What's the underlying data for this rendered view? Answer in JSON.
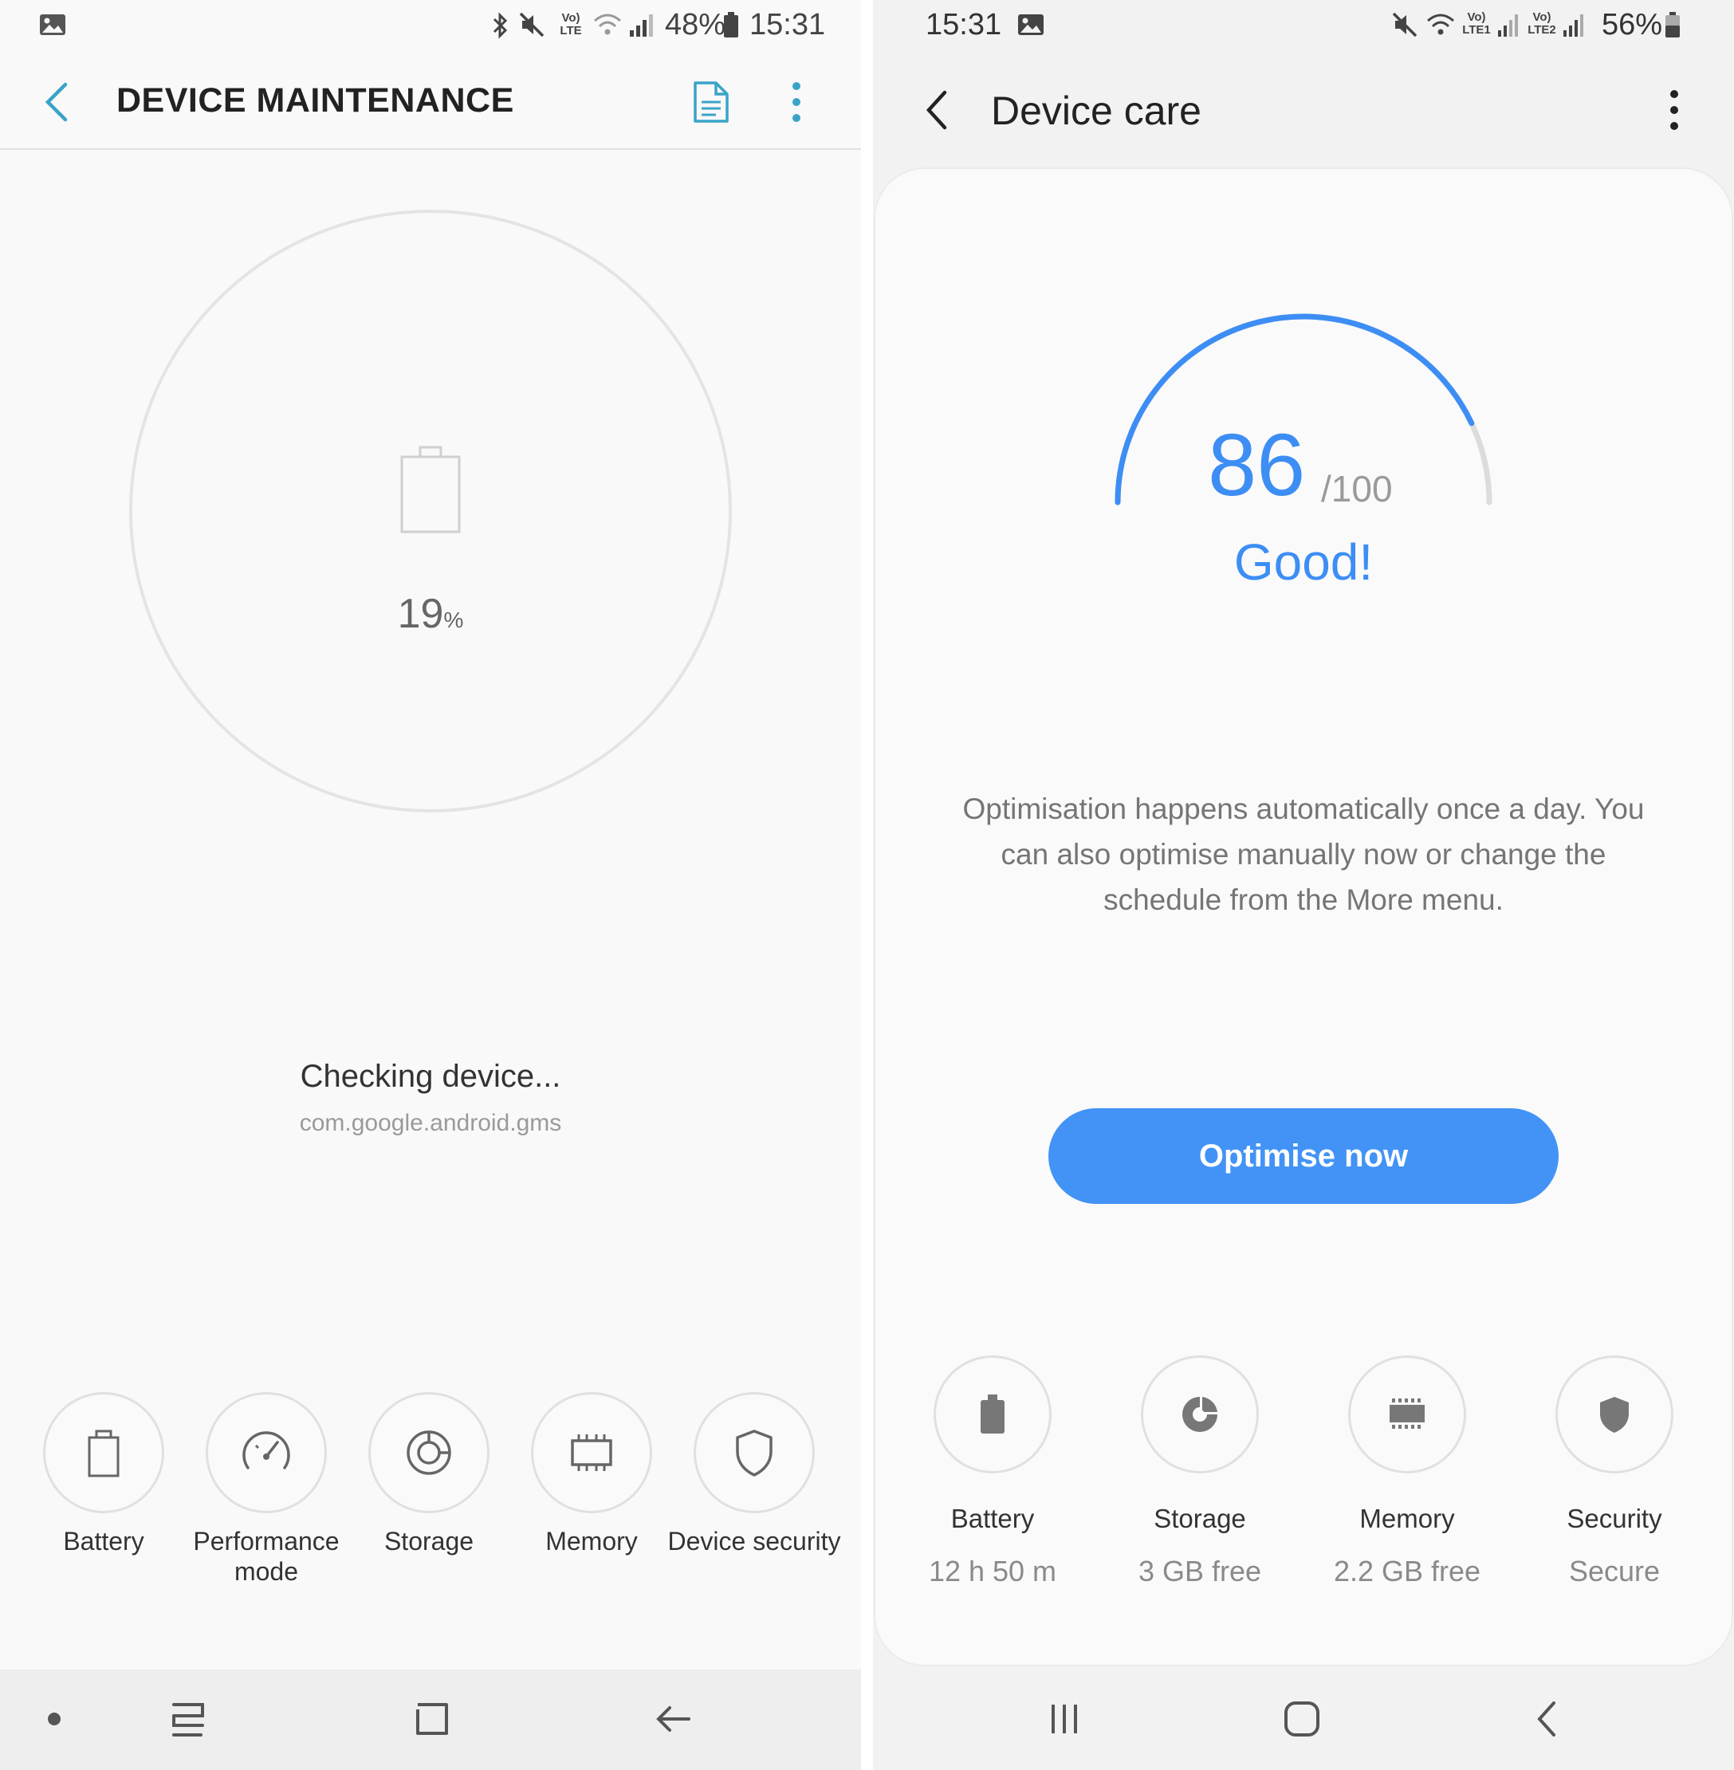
{
  "left": {
    "status": {
      "battery": "48%",
      "time": "15:31",
      "volte": "Vo) LTE"
    },
    "title": "DEVICE MAINTENANCE",
    "progress": {
      "value": "19",
      "unit": "%"
    },
    "checking": "Checking device...",
    "package": "com.google.android.gms",
    "tiles": [
      {
        "label": "Battery",
        "icon": "battery-icon"
      },
      {
        "label": "Performance mode",
        "icon": "speedometer-icon"
      },
      {
        "label": "Storage",
        "icon": "storage-icon"
      },
      {
        "label": "Memory",
        "icon": "memory-chip-icon"
      },
      {
        "label": "Device security",
        "icon": "shield-icon"
      }
    ]
  },
  "right": {
    "status": {
      "time": "15:31",
      "battery": "56%",
      "sim1": "Vo) LTE1",
      "sim2": "Vo) LTE2"
    },
    "title": "Device care",
    "score": {
      "value": 86,
      "max": "/100",
      "fraction": 0.86,
      "verdict": "Good!"
    },
    "description": "Optimisation happens automatically once a day. You can also optimise manually now or change the schedule from the More menu.",
    "optimise_label": "Optimise now",
    "tiles": [
      {
        "label": "Battery",
        "value": "12 h 50 m",
        "icon": "battery-icon"
      },
      {
        "label": "Storage",
        "value": "3 GB free",
        "icon": "pie-chart-icon"
      },
      {
        "label": "Memory",
        "value": "2.2 GB free",
        "icon": "memory-chip-icon"
      },
      {
        "label": "Security",
        "value": "Secure",
        "icon": "shield-icon"
      }
    ]
  },
  "colors": {
    "accent": "#3d8ef4",
    "button": "#4293f5",
    "left_accent": "#3aa3c8"
  }
}
